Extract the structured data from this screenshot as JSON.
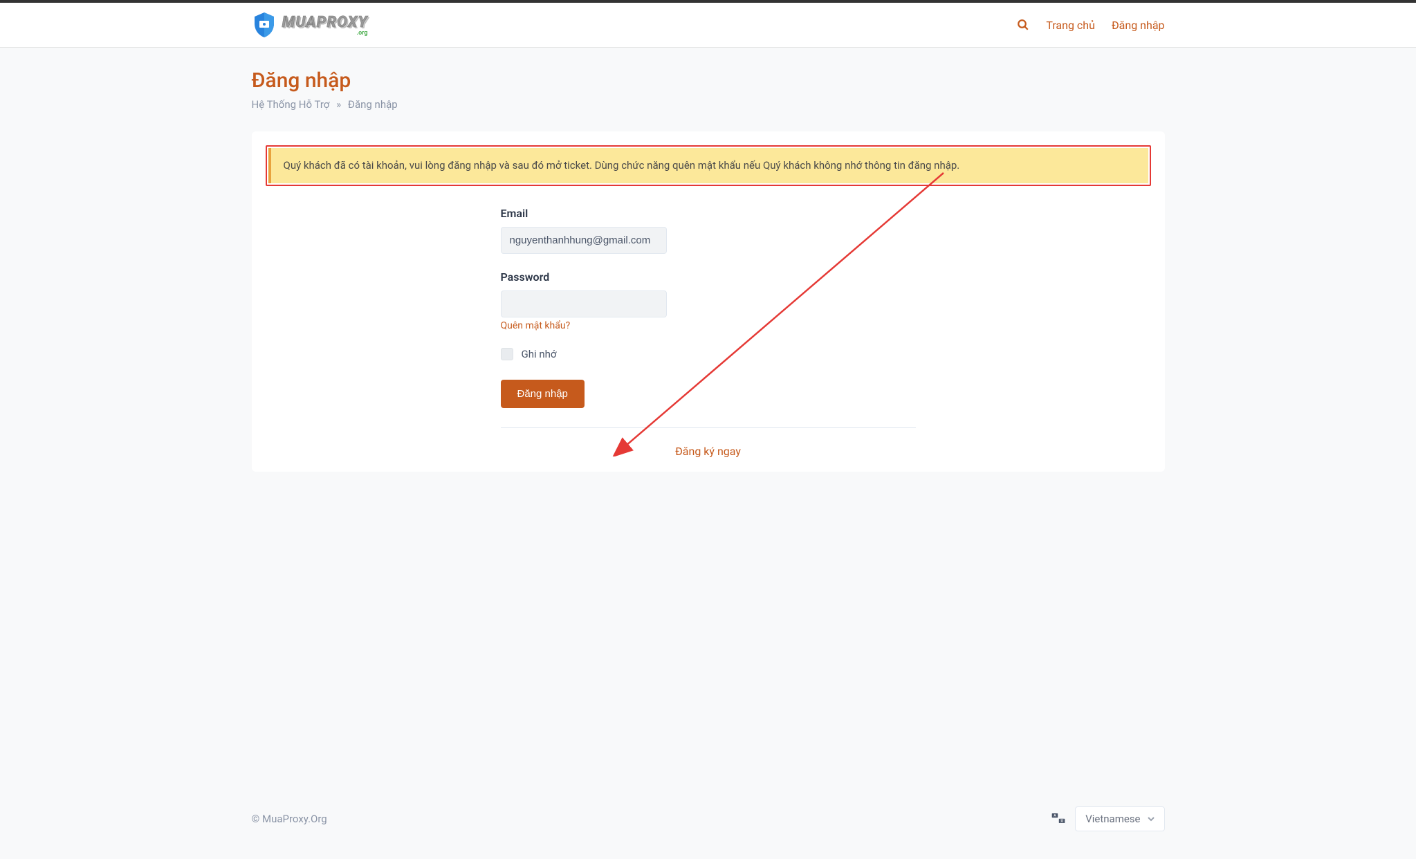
{
  "brand": {
    "name": "MUAPROXY",
    "sub": ".org"
  },
  "nav": {
    "home": "Trang chủ",
    "login": "Đăng nhập"
  },
  "page": {
    "title": "Đăng nhập"
  },
  "breadcrumb": {
    "root": "Hệ Thống Hỗ Trợ",
    "sep": "»",
    "current": "Đăng nhập"
  },
  "alert": {
    "message": "Quý khách đã có tài khoản, vui lòng đăng nhập và sau đó mở ticket. Dùng chức năng quên mật khẩu nếu Quý khách không nhớ thông tin đăng nhập."
  },
  "form": {
    "email_label": "Email",
    "email_value": "nguyenthanhhung@gmail.com",
    "password_label": "Password",
    "password_value": "",
    "forgot": "Quên mật khẩu?",
    "remember": "Ghi nhớ",
    "submit": "Đăng nhập",
    "register": "Đăng ký ngay"
  },
  "footer": {
    "copyright": "© MuaProxy.Org",
    "language": "Vietnamese"
  }
}
